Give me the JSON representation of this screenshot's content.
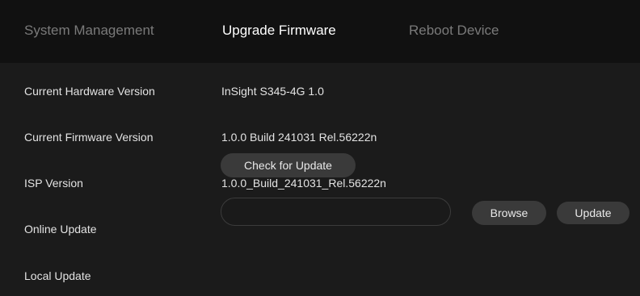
{
  "tabs": {
    "system_management": "System Management",
    "upgrade_firmware": "Upgrade Firmware",
    "reboot_device": "Reboot Device",
    "active": "upgrade_firmware"
  },
  "rows": {
    "hardware_version": {
      "label": "Current Hardware Version",
      "value": "InSight S345-4G 1.0"
    },
    "firmware_version": {
      "label": "Current Firmware Version",
      "value": "1.0.0 Build 241031 Rel.56222n"
    },
    "isp_version": {
      "label": "ISP Version",
      "value": "1.0.0_Build_241031_Rel.56222n"
    },
    "online_update": {
      "label": "Online Update",
      "button": "Check for Update"
    },
    "local_update": {
      "label": "Local Update",
      "file_value": "",
      "browse_button": "Browse",
      "update_button": "Update"
    }
  },
  "colors": {
    "tab_bar_bg": "#111111",
    "content_bg": "#1b1b1b",
    "button_bg": "#3a3a3a",
    "active_tab_text": "#ffffff",
    "inactive_tab_text": "#7a7a7a"
  }
}
